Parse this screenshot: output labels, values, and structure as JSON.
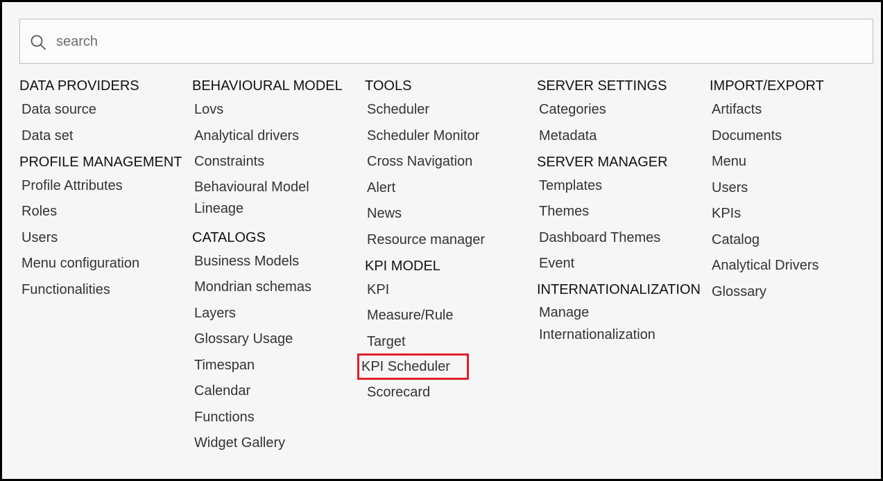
{
  "search": {
    "placeholder": "search",
    "icon": "search-icon"
  },
  "columns": [
    {
      "sections": [
        {
          "title": "DATA PROVIDERS",
          "items": [
            "Data source",
            "Data set"
          ]
        },
        {
          "title": "PROFILE MANAGEMENT",
          "items": [
            "Profile Attributes",
            "Roles",
            "Users",
            "Menu configuration",
            "Functionalities"
          ]
        }
      ]
    },
    {
      "sections": [
        {
          "title": "BEHAVIOURAL MODEL",
          "items": [
            "Lovs",
            "Analytical drivers",
            "Constraints",
            "Behavioural Model Lineage"
          ]
        },
        {
          "title": "CATALOGS",
          "items": [
            "Business Models",
            "Mondrian schemas",
            "Layers",
            "Glossary Usage",
            "Timespan",
            "Calendar",
            "Functions",
            "Widget Gallery"
          ]
        }
      ]
    },
    {
      "sections": [
        {
          "title": "TOOLS",
          "items": [
            "Scheduler",
            "Scheduler Monitor",
            "Cross Navigation",
            "Alert",
            "News",
            "Resource manager"
          ]
        },
        {
          "title": "KPI MODEL",
          "items": [
            "KPI",
            "Measure/Rule",
            "Target",
            "KPI Scheduler",
            "Scorecard"
          ]
        }
      ]
    },
    {
      "sections": [
        {
          "title": "SERVER SETTINGS",
          "items": [
            "Categories",
            "Metadata"
          ]
        },
        {
          "title": "SERVER MANAGER",
          "items": [
            "Templates",
            "Themes",
            "Dashboard Themes",
            "Event"
          ]
        },
        {
          "title": "INTERNATIONALIZATION",
          "items": [
            "Manage Internationalization"
          ]
        }
      ]
    },
    {
      "sections": [
        {
          "title": "IMPORT/EXPORT",
          "items": [
            "Artifacts",
            "Documents",
            "Menu",
            "Users",
            "KPIs",
            "Catalog",
            "Analytical Drivers",
            "Glossary"
          ]
        }
      ]
    }
  ],
  "highlight_color": "#e0202b"
}
